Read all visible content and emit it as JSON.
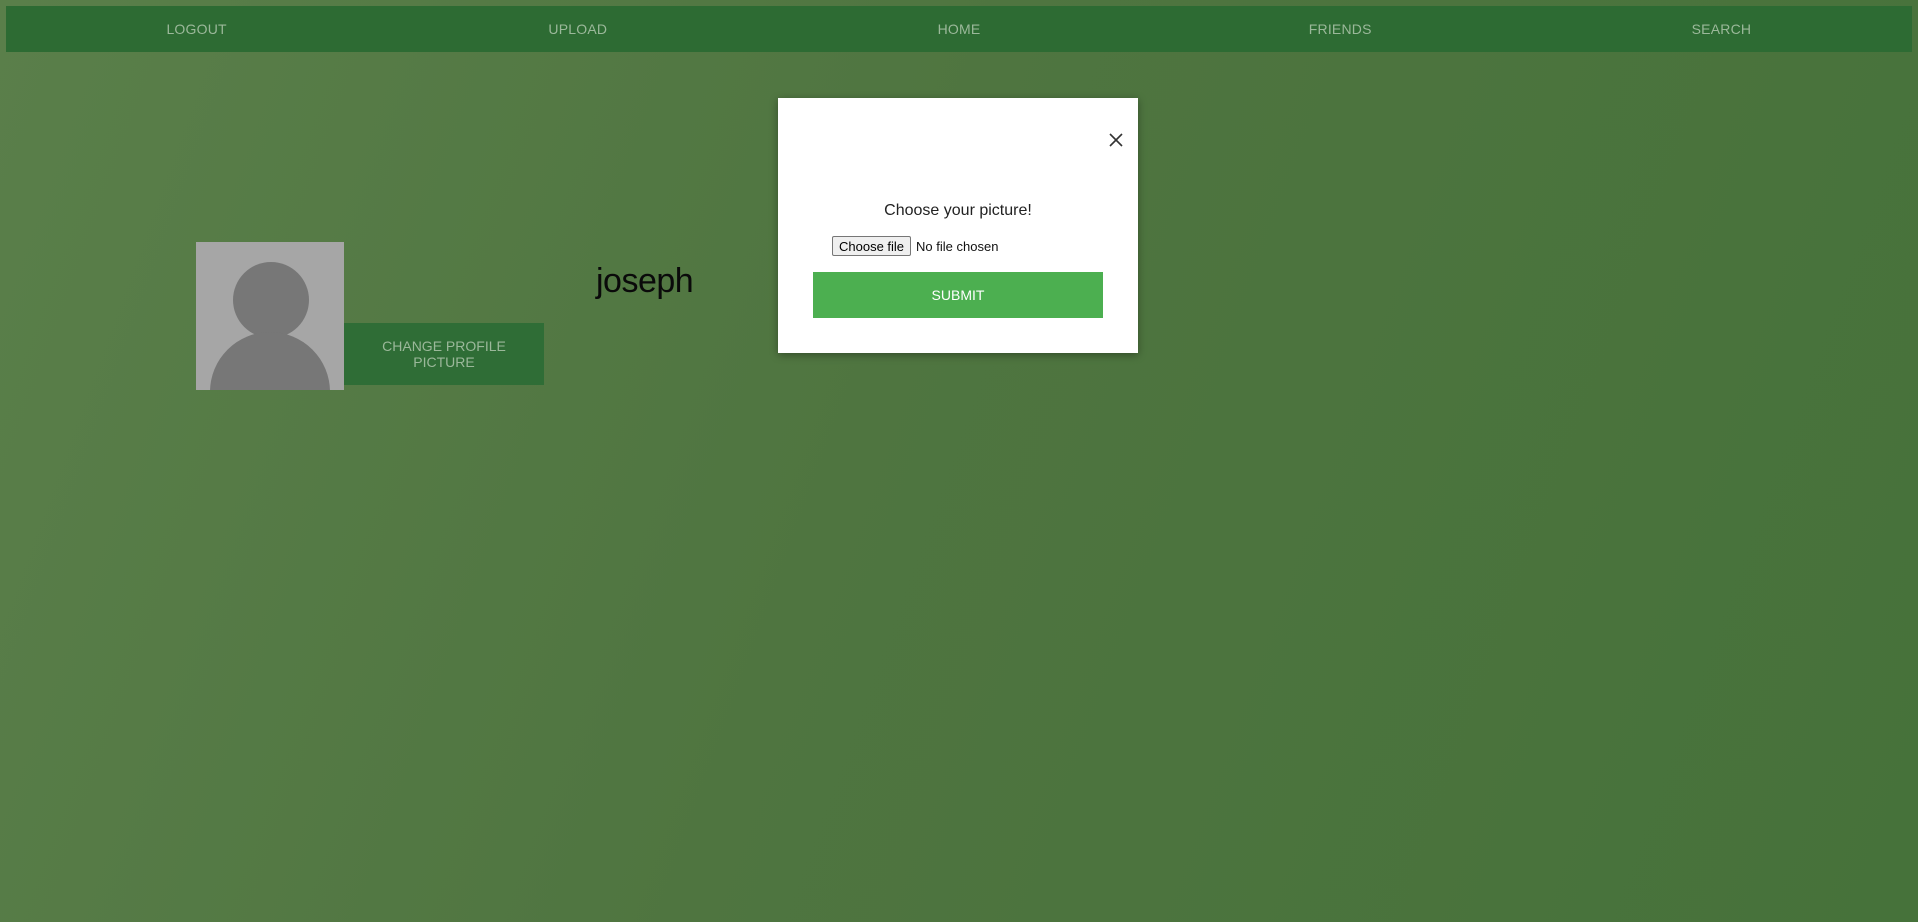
{
  "nav": {
    "items": [
      {
        "label": "LOGOUT"
      },
      {
        "label": "UPLOAD"
      },
      {
        "label": "HOME"
      },
      {
        "label": "FRIENDS"
      },
      {
        "label": "SEARCH"
      }
    ]
  },
  "profile": {
    "username": "joseph",
    "change_picture_label": "CHANGE PROFILE PICTURE",
    "avatar_icon": "person-placeholder-icon"
  },
  "modal": {
    "title": "Choose your picture!",
    "choose_file_label": "Choose file",
    "file_status": "No file chosen",
    "submit_label": "SUBMIT",
    "close_icon": "close-icon"
  },
  "colors": {
    "navbar": "#2d6b33",
    "background": "#507a44",
    "submit": "#4caf50",
    "change_button": "#2f6d36"
  }
}
